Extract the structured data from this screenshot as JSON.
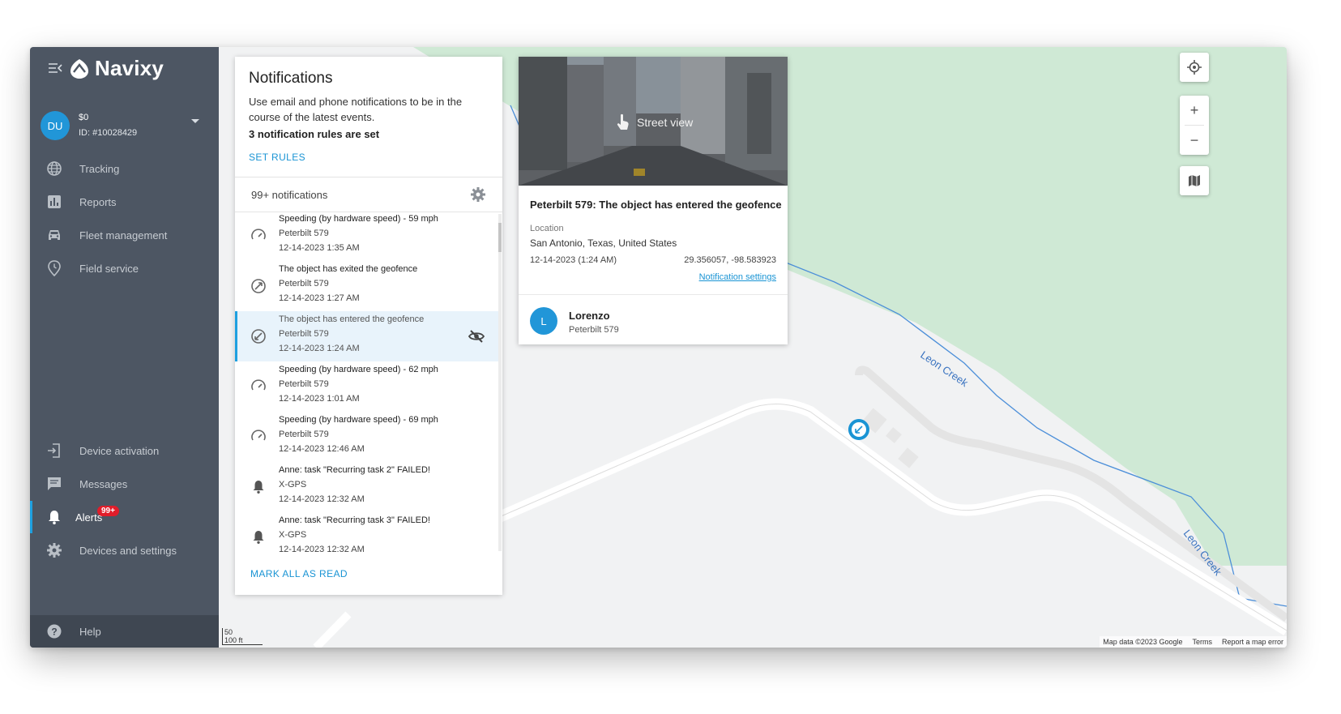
{
  "app": {
    "logo_text": "Navixy"
  },
  "account": {
    "avatar_initials": "DU",
    "balance": "$0",
    "id_text": "ID: #10028429"
  },
  "sidebar": {
    "nav_top": [
      {
        "label": "Tracking",
        "icon": "globe-icon"
      },
      {
        "label": "Reports",
        "icon": "bar-chart-icon"
      },
      {
        "label": "Fleet management",
        "icon": "car-icon"
      },
      {
        "label": "Field service",
        "icon": "location-clock-icon"
      }
    ],
    "nav_bottom": [
      {
        "label": "Device activation",
        "icon": "login-icon"
      },
      {
        "label": "Messages",
        "icon": "message-icon"
      },
      {
        "label": "Alerts",
        "icon": "bell-icon",
        "badge": "99+"
      },
      {
        "label": "Devices and settings",
        "icon": "gear-icon"
      },
      {
        "label": "Help",
        "icon": "help-icon"
      }
    ]
  },
  "notifications": {
    "title": "Notifications",
    "description": "Use email and phone notifications to be in the course of the latest events.",
    "rules_count": "3 notification rules are set",
    "set_rules_label": "SET RULES",
    "count_label": "99+ notifications",
    "mark_all_label": "MARK ALL AS READ",
    "items": [
      {
        "title": "Speeding (by hardware speed) - 59 mph",
        "source": "Peterbilt 579",
        "date": "12-14-2023 1:35 AM",
        "icon": "speedometer-icon"
      },
      {
        "title": "The object has exited the geofence",
        "source": "Peterbilt 579",
        "date": "12-14-2023 1:27 AM",
        "icon": "geofence-exit-icon"
      },
      {
        "title": "The object has entered the geofence",
        "source": "Peterbilt 579",
        "date": "12-14-2023 1:24 AM",
        "icon": "geofence-enter-icon",
        "selected": true
      },
      {
        "title": "Speeding (by hardware speed) - 62 mph",
        "source": "Peterbilt 579",
        "date": "12-14-2023 1:01 AM",
        "icon": "speedometer-icon"
      },
      {
        "title": "Speeding (by hardware speed) - 69 mph",
        "source": "Peterbilt 579",
        "date": "12-14-2023 12:46 AM",
        "icon": "speedometer-icon"
      },
      {
        "title": "Anne: task \"Recurring task 2\" FAILED!",
        "source": "X-GPS",
        "date": "12-14-2023 12:32 AM",
        "icon": "bell-icon"
      },
      {
        "title": "Anne: task \"Recurring task 3\" FAILED!",
        "source": "X-GPS",
        "date": "12-14-2023 12:32 AM",
        "icon": "bell-icon"
      }
    ]
  },
  "detail": {
    "street_view_label": "Street view",
    "event_title": "Peterbilt 579: The object has entered the geofence",
    "location_label": "Location",
    "location_value": "San Antonio, Texas, United States",
    "event_time": "12-14-2023 (1:24 AM)",
    "coordinates": "29.356057, -98.583923",
    "settings_link": "Notification settings",
    "employee_initial": "L",
    "employee_name": "Lorenzo",
    "employee_object": "Peterbilt 579"
  },
  "map": {
    "creek_label": "Leon Creek",
    "zoom_in": "+",
    "zoom_out": "−",
    "footer": {
      "data": "Map data ©2023 Google",
      "terms": "Terms",
      "report": "Report a map error"
    },
    "scale_top": "50",
    "scale_bottom": "100 ft"
  },
  "colors": {
    "sidebar": "#4d5663",
    "accent": "#1a94d4",
    "badge": "#e11d2a",
    "park": "#cfe9d5",
    "water": "#4c8fd9"
  }
}
